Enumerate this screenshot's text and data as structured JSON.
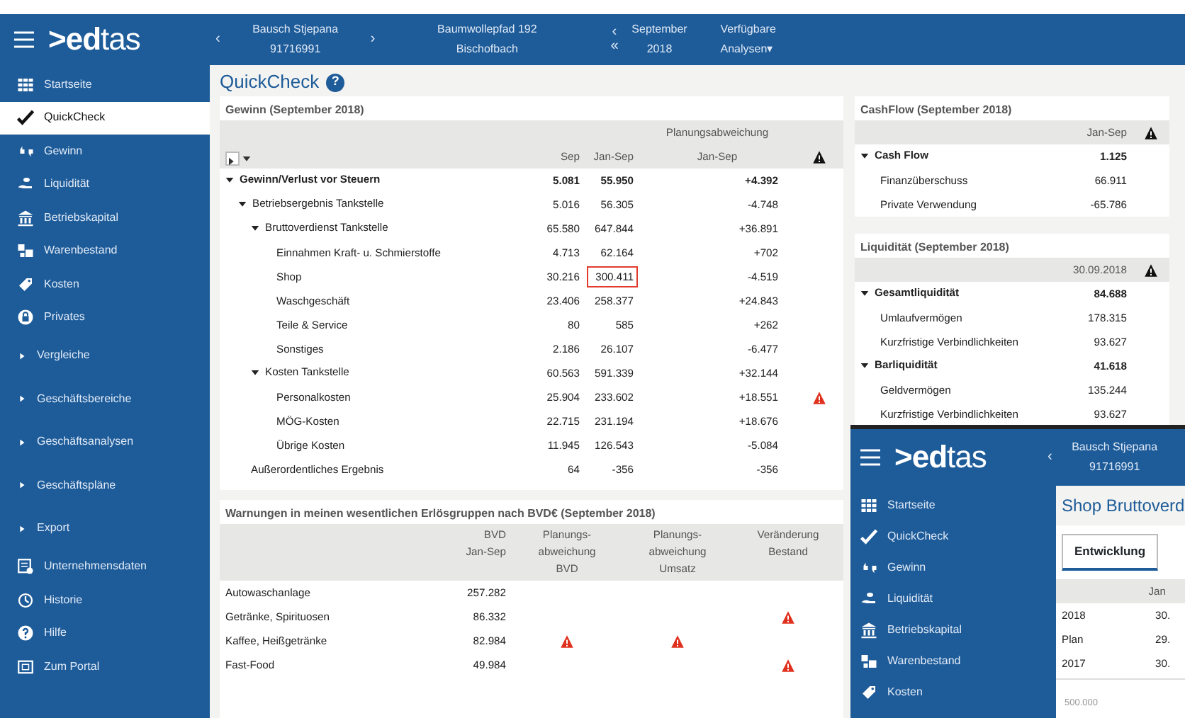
{
  "header": {
    "logo": "**>ed**tas",
    "prev": "‹",
    "client": {
      "name": "Bausch Stjepana",
      "number": "91716991"
    },
    "next": "›",
    "address": {
      "street": "Baumwollepfad 192",
      "city": "Bischofbach"
    },
    "period_prev": "‹",
    "period_first": "«",
    "period": {
      "month": "September",
      "year": "2018"
    },
    "analyses": {
      "line1": "Verfügbare",
      "line2": "Analysen▾"
    }
  },
  "sidebar": {
    "items": [
      {
        "label": "Startseite",
        "kind": "link",
        "selected": false
      },
      {
        "label": "QuickCheck",
        "kind": "link",
        "selected": true
      },
      {
        "label": "Gewinn",
        "kind": "link",
        "selected": false
      },
      {
        "label": "Liquidität",
        "kind": "link",
        "selected": false
      },
      {
        "label": "Betriebskapital",
        "kind": "link",
        "selected": false
      },
      {
        "label": "Warenbestand",
        "kind": "link",
        "selected": false
      },
      {
        "label": "Kosten",
        "kind": "link",
        "selected": false
      },
      {
        "label": "Privates",
        "kind": "link",
        "selected": false
      },
      {
        "label": "Vergleiche",
        "kind": "group",
        "selected": false
      },
      {
        "label": "Geschäftsbereiche",
        "kind": "group",
        "selected": false
      },
      {
        "label": "Geschäftsanalysen",
        "kind": "group",
        "selected": false
      },
      {
        "label": "Geschäftspläne",
        "kind": "group",
        "selected": false
      },
      {
        "label": "Export",
        "kind": "group",
        "selected": false
      },
      {
        "label": "Unternehmensdaten",
        "kind": "link",
        "selected": false
      },
      {
        "label": "Historie",
        "kind": "link",
        "selected": false
      },
      {
        "label": "Hilfe",
        "kind": "link",
        "selected": false
      },
      {
        "label": "Zum Portal",
        "kind": "link",
        "selected": false
      }
    ]
  },
  "page_title": "QuickCheck",
  "help": "?",
  "gewinn": {
    "title": "Gewinn (September 2018)",
    "group_header": "Planungsabweichung",
    "columns": [
      "Sep",
      "Jan-Sep",
      "Jan-Sep"
    ],
    "rows": [
      {
        "label": "Gewinn/Verlust vor Steuern",
        "sep": "5.081",
        "jan": "55.950",
        "dev": "+4.392",
        "warning": false,
        "jan_selected": false,
        "expanded": true,
        "children": [
          {
            "label": "Betriebsergebnis Tankstelle",
            "sep": "5.016",
            "jan": "56.305",
            "dev": "-4.748",
            "warning": false,
            "jan_selected": false,
            "expanded": true,
            "children": [
              {
                "label": "Bruttoverdienst Tankstelle",
                "sep": "65.580",
                "jan": "647.844",
                "dev": "+36.891",
                "warning": false,
                "jan_selected": false,
                "expanded": true,
                "children": [
                  {
                    "label": "Einnahmen Kraft- u. Schmierstoffe",
                    "sep": "4.713",
                    "jan": "62.164",
                    "dev": "+702",
                    "warning": false,
                    "jan_selected": false
                  },
                  {
                    "label": "Shop",
                    "sep": "30.216",
                    "jan": "300.411",
                    "dev": "-4.519",
                    "warning": false,
                    "jan_selected": true
                  },
                  {
                    "label": "Waschgeschäft",
                    "sep": "23.406",
                    "jan": "258.377",
                    "dev": "+24.843",
                    "warning": false,
                    "jan_selected": false
                  },
                  {
                    "label": "Teile & Service",
                    "sep": "80",
                    "jan": "585",
                    "dev": "+262",
                    "warning": false,
                    "jan_selected": false
                  },
                  {
                    "label": "Sonstiges",
                    "sep": "2.186",
                    "jan": "26.107",
                    "dev": "-6.477",
                    "warning": false,
                    "jan_selected": false
                  }
                ]
              },
              {
                "label": "Kosten Tankstelle",
                "sep": "60.563",
                "jan": "591.339",
                "dev": "+32.144",
                "warning": false,
                "jan_selected": false,
                "expanded": true,
                "children": [
                  {
                    "label": "Personalkosten",
                    "sep": "25.904",
                    "jan": "233.602",
                    "dev": "+18.551",
                    "warning": true,
                    "jan_selected": false
                  },
                  {
                    "label": "MÖG-Kosten",
                    "sep": "22.715",
                    "jan": "231.194",
                    "dev": "+18.676",
                    "warning": false,
                    "jan_selected": false
                  },
                  {
                    "label": "Übrige Kosten",
                    "sep": "11.945",
                    "jan": "126.543",
                    "dev": "-5.084",
                    "warning": false,
                    "jan_selected": false
                  }
                ]
              }
            ]
          },
          {
            "label": "Außerordentliches Ergebnis",
            "sep": "64",
            "jan": "-356",
            "dev": "-356",
            "warning": false,
            "jan_selected": false
          }
        ]
      }
    ]
  },
  "cashflow": {
    "title": "CashFlow (September 2018)",
    "column": "Jan-Sep",
    "rows": [
      {
        "label": "Cash Flow",
        "value": "1.125",
        "expanded": true,
        "children": [
          {
            "label": "Finanzüberschuss",
            "value": "66.911"
          },
          {
            "label": "Private Verwendung",
            "value": "-65.786"
          }
        ]
      }
    ]
  },
  "liquiditaet": {
    "title": "Liquidität (September 2018)",
    "column": "30.09.2018",
    "rows": [
      {
        "label": "Gesamtliquidität",
        "value": "84.688",
        "expanded": true,
        "children": [
          {
            "label": "Umlaufvermögen",
            "value": "178.315"
          },
          {
            "label": "Kurzfristige Verbindlichkeiten",
            "value": "93.627"
          }
        ]
      },
      {
        "label": "Barliquidität",
        "value": "41.618",
        "expanded": true,
        "children": [
          {
            "label": "Geldvermögen",
            "value": "135.244"
          },
          {
            "label": "Kurzfristige Verbindlichkeiten",
            "value": "93.627"
          }
        ]
      }
    ]
  },
  "warnungen": {
    "title": "Warnungen in meinen wesentlichen Erlösgruppen nach BVD€ (September 2018)",
    "columns": [
      [
        "BVD",
        "Jan-Sep"
      ],
      [
        "Planungs-",
        "abweichung",
        "BVD"
      ],
      [
        "Planungs-",
        "abweichung",
        "Umsatz"
      ],
      [
        "Veränderung",
        "Bestand"
      ]
    ],
    "rows": [
      {
        "label": "Autowaschanlage",
        "value": "257.282",
        "warnings": [
          false,
          false,
          false
        ]
      },
      {
        "label": "Getränke, Spirituosen",
        "value": "86.332",
        "warnings": [
          false,
          false,
          true
        ]
      },
      {
        "label": "Kaffee, Heißgetränke",
        "value": "82.984",
        "warnings": [
          true,
          true,
          false
        ]
      },
      {
        "label": "Fast-Food",
        "value": "49.984",
        "warnings": [
          false,
          false,
          true
        ]
      }
    ]
  },
  "overlay": {
    "logo": "**>ed**tas",
    "prev": "‹",
    "client": {
      "name": "Bausch Stjepana",
      "number": "91716991"
    },
    "sidebar": [
      "Startseite",
      "QuickCheck",
      "Gewinn",
      "Liquidität",
      "Betriebskapital",
      "Warenbestand",
      "Kosten"
    ],
    "title": "Shop Bruttoverd",
    "tabs": [
      {
        "label": "Entwicklung",
        "selected": true
      }
    ],
    "column": "Jan",
    "rows": [
      {
        "label": "2018",
        "value": "30."
      },
      {
        "label": "Plan",
        "value": "29."
      },
      {
        "label": "2017",
        "value": "30."
      }
    ],
    "axis_label": "500.000"
  }
}
